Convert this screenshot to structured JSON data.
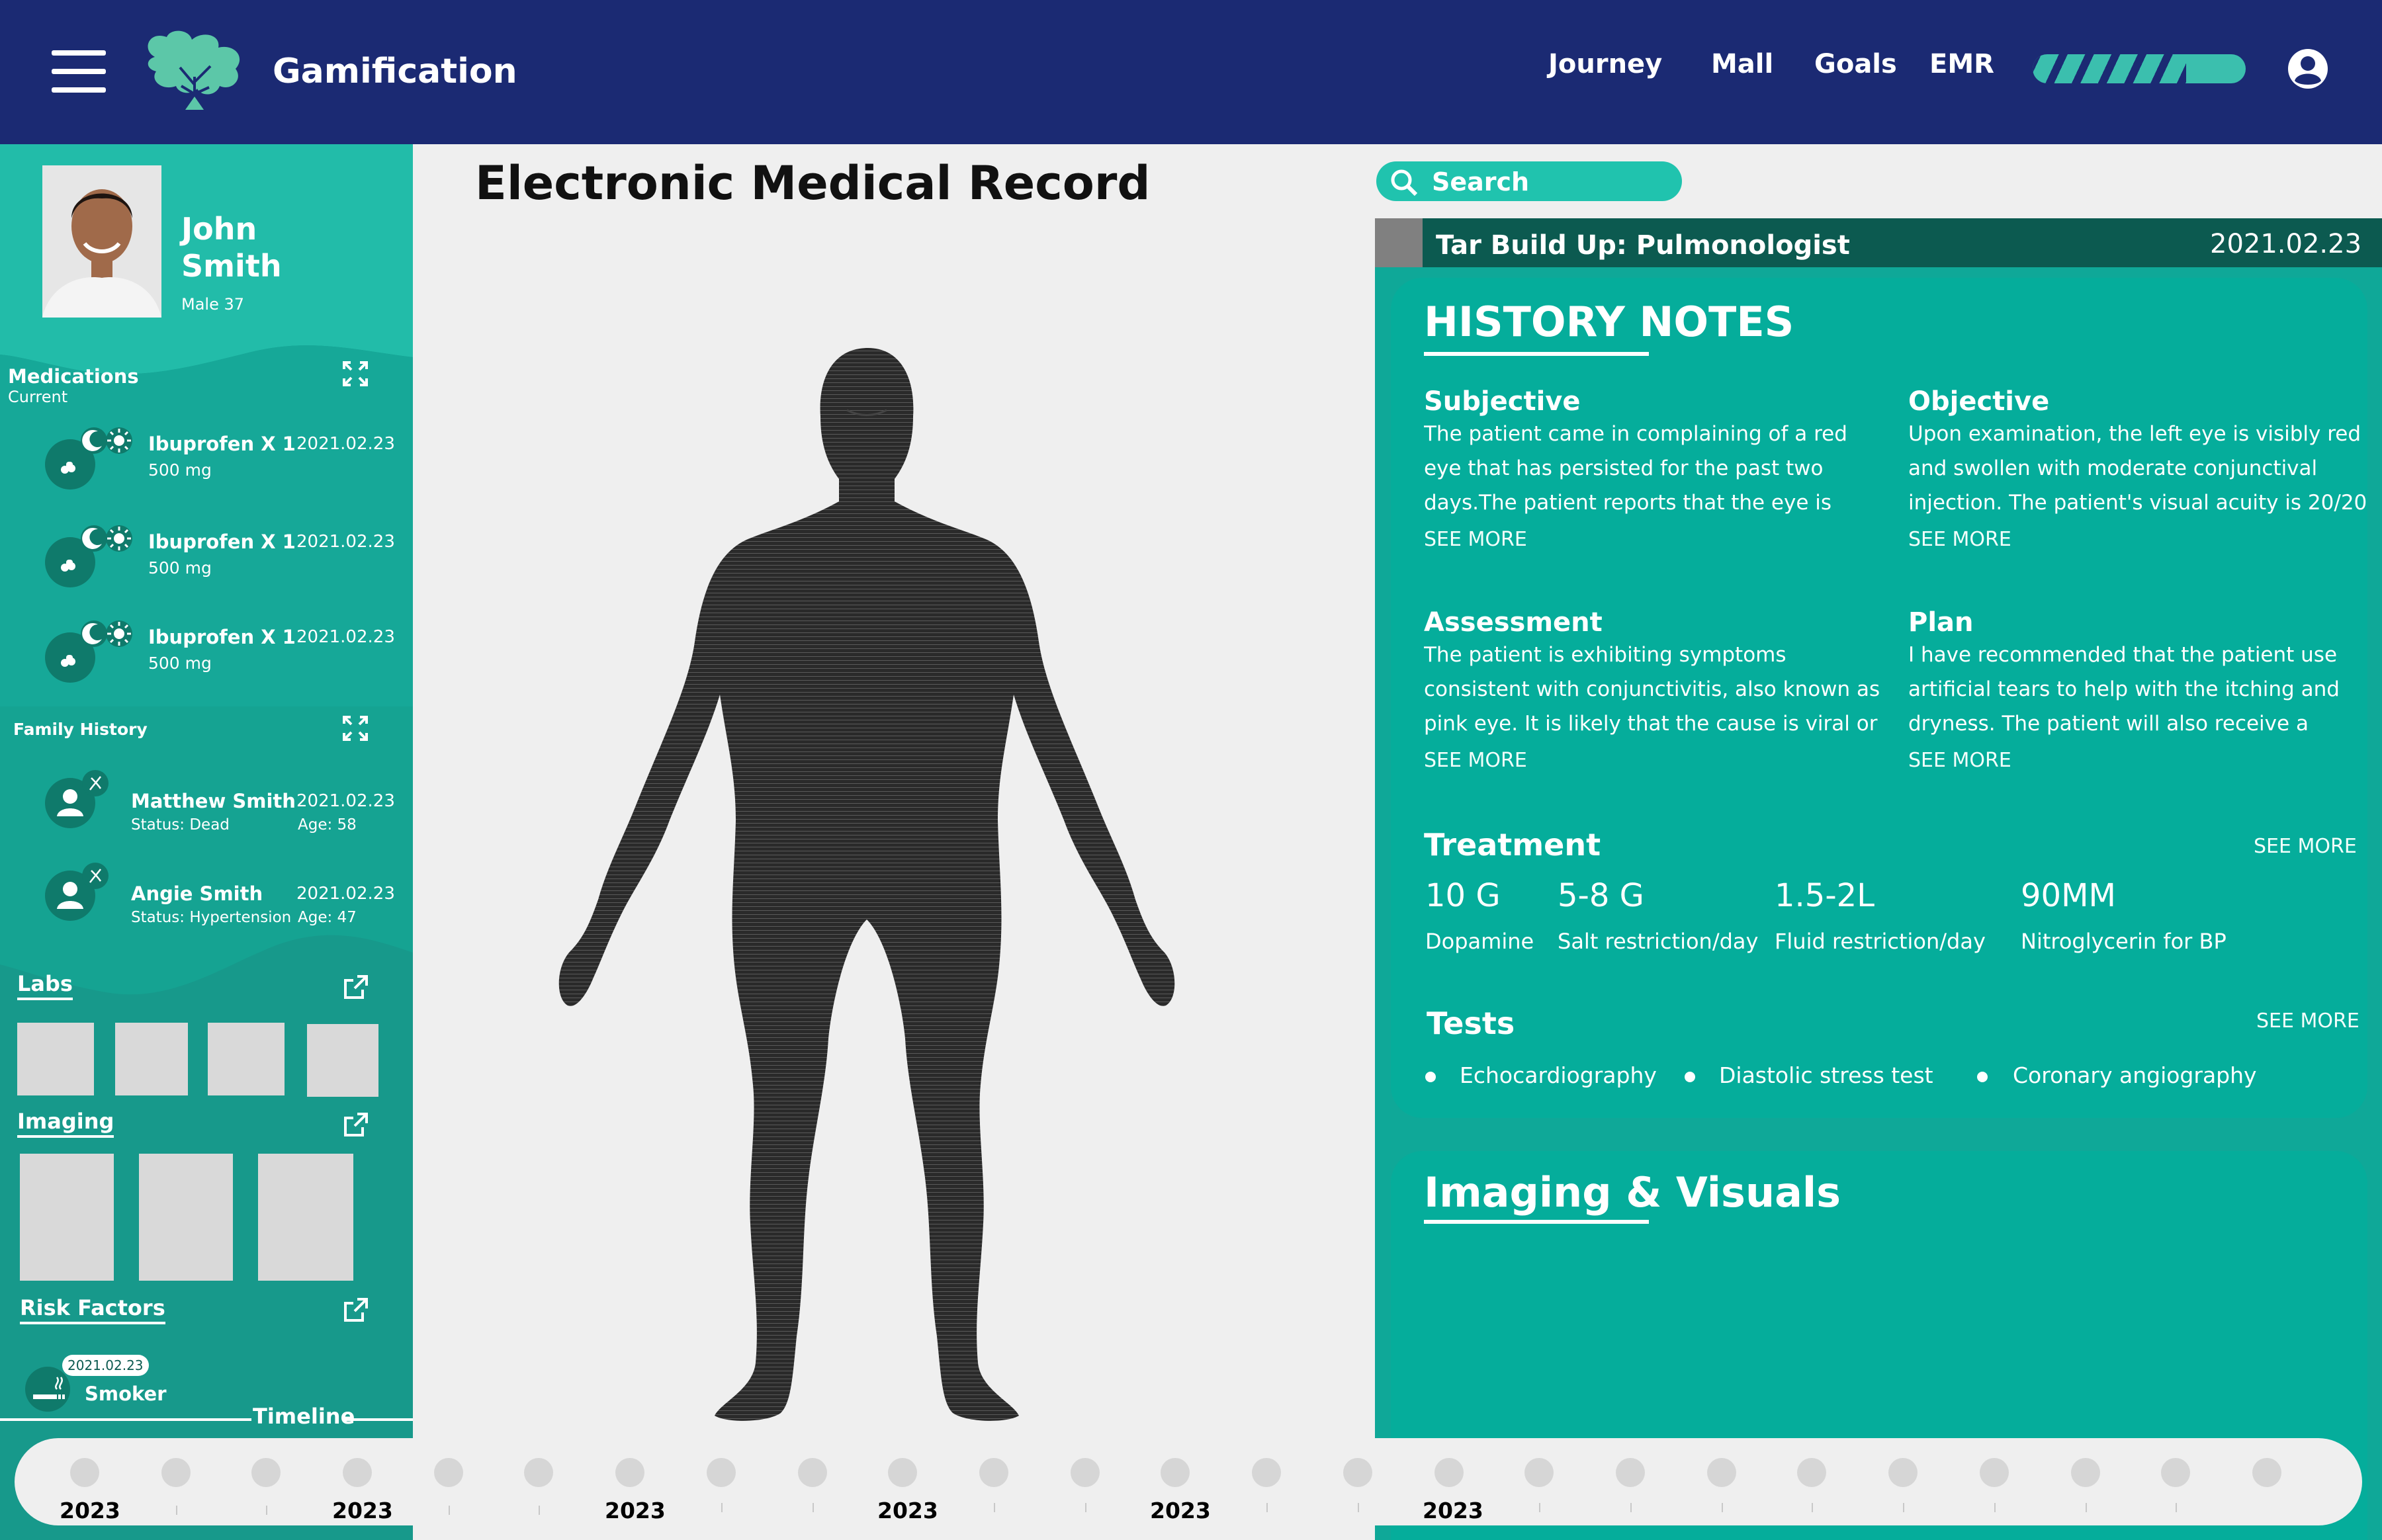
{
  "header": {
    "app_title": "Gamification",
    "nav": [
      "Journey",
      "Mall",
      "Goals",
      "EMR"
    ],
    "progress": 0.72,
    "colors": {
      "bar": "#1b2a73",
      "accent": "#3bbfae"
    }
  },
  "patient": {
    "first_name": "John",
    "last_name": "Smith",
    "meta": "Male 37"
  },
  "medications": {
    "title": "Medications",
    "subtitle": "Current",
    "items": [
      {
        "name": "Ibuprofen X 1",
        "dose": "500 mg",
        "date": "2021.02.23"
      },
      {
        "name": "Ibuprofen X 1",
        "dose": "500 mg",
        "date": "2021.02.23"
      },
      {
        "name": "Ibuprofen X 1",
        "dose": "500 mg",
        "date": "2021.02.23"
      }
    ]
  },
  "family_history": {
    "title": "Family History",
    "items": [
      {
        "name": "Matthew Smith",
        "status": "Status: Dead",
        "date": "2021.02.23",
        "age": "Age: 58"
      },
      {
        "name": "Angie Smith",
        "status": "Status: Hypertension",
        "date": "2021.02.23",
        "age": "Age: 47"
      }
    ]
  },
  "labs": {
    "title": "Labs"
  },
  "imaging": {
    "title": "Imaging"
  },
  "risk_factors": {
    "title": "Risk Factors",
    "item": {
      "date": "2021.02.23",
      "label": "Smoker"
    }
  },
  "timeline": {
    "title": "Timeline",
    "years": [
      "2023",
      "2023",
      "2023",
      "2023",
      "2023",
      "2023"
    ]
  },
  "main": {
    "title": "Electronic Medical Record"
  },
  "search": {
    "placeholder": "Search"
  },
  "record": {
    "title": "Tar Build Up: Pulmonologist",
    "date": "2021.02.23",
    "history_title": "HISTORY NOTES",
    "notes": {
      "subjective": {
        "title": "Subjective",
        "body": "The patient came in complaining of a red eye that has persisted for the past two days.The patient reports that the eye is itchy",
        "more": "SEE MORE"
      },
      "objective": {
        "title": "Objective",
        "body": "Upon examination, the left eye is visibly red and swollen with moderate conjunctival injection. The patient's visual acuity is 20/20",
        "more": "SEE MORE"
      },
      "assessment": {
        "title": "Assessment",
        "body": "The patient is exhibiting symptoms consistent with conjunctivitis, also known as pink eye. It is likely that the cause is viral or allergic in nature,",
        "more": "SEE MORE"
      },
      "plan": {
        "title": "Plan",
        "body": "I have recommended that the patient use artificial tears to help with the itching and dryness. The patient will also receive a",
        "more": "SEE MORE"
      }
    },
    "treatment": {
      "title": "Treatment",
      "more": "SEE MORE",
      "items": [
        {
          "value": "10 G",
          "label": "Dopamine"
        },
        {
          "value": "5-8 G",
          "label": "Salt restriction/day"
        },
        {
          "value": "1.5-2L",
          "label": "Fluid restriction/day"
        },
        {
          "value": "90MM",
          "label": "Nitroglycerin for BP"
        }
      ]
    },
    "tests": {
      "title": "Tests",
      "more": "SEE MORE",
      "items": [
        "Echocardiography",
        "Diastolic stress test",
        "Coronary angiography"
      ]
    },
    "imaging_title": "Imaging & Visuals"
  }
}
